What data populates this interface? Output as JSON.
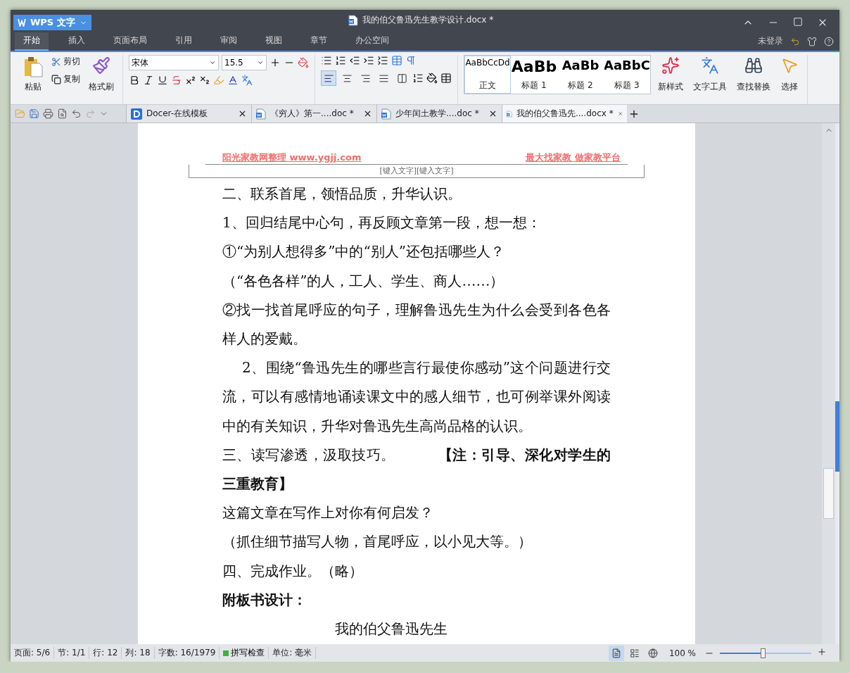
{
  "app": {
    "logo": "WPS 文字"
  },
  "window": {
    "title": "我的伯父鲁迅先生教学设计.docx *"
  },
  "menu_tabs": [
    {
      "label": "开始",
      "selected": true
    },
    {
      "label": "插入",
      "selected": false
    },
    {
      "label": "页面布局",
      "selected": false
    },
    {
      "label": "引用",
      "selected": false
    },
    {
      "label": "审阅",
      "selected": false
    },
    {
      "label": "视图",
      "selected": false
    },
    {
      "label": "章节",
      "selected": false
    },
    {
      "label": "办公空间",
      "selected": false
    }
  ],
  "account": "未登录",
  "ribbon": {
    "paste": "粘贴",
    "cut": "剪切",
    "copy": "复制",
    "format_painter": "格式刷",
    "font": {
      "name": "宋体",
      "size": "15.5"
    },
    "align_buttons": [
      {
        "selected": true
      },
      {
        "selected": false
      },
      {
        "selected": false
      },
      {
        "selected": false
      },
      {
        "selected": false
      }
    ],
    "styles": [
      {
        "preview": "AaBbCcDd",
        "label": "正文",
        "selected": true
      },
      {
        "preview": "AaBb",
        "label": "标题 1",
        "selected": false
      },
      {
        "preview": "AaBb",
        "label": "标题 2",
        "selected": false
      },
      {
        "preview": "AaBbC",
        "label": "标题 3",
        "selected": false
      }
    ],
    "tools": [
      "新样式",
      "文字工具",
      "查找替换",
      "选择"
    ]
  },
  "doc_tabs": [
    {
      "label": "Docer-在线模板",
      "kind": "docer",
      "selected": false
    },
    {
      "label": "《穷人》第一....doc *",
      "kind": "word",
      "selected": false
    },
    {
      "label": "少年闰土教学....doc *",
      "kind": "word",
      "selected": false
    },
    {
      "label": "我的伯父鲁迅先....docx *",
      "kind": "word",
      "selected": true
    }
  ],
  "header": {
    "left": "阳光家教网整理 www.ygjj.com",
    "right": "最大找家教 做家教平台",
    "placeholder": "[键入文字][键入文字]"
  },
  "paragraphs": [
    {
      "kind": "plain",
      "text": "二、联系首尾，领悟品质，升华认识。"
    },
    {
      "kind": "plain",
      "text": "1、回归结尾中心句，再反顾文章第一段，想一想："
    },
    {
      "kind": "plain",
      "text": "①“为别人想得多”中的“别人”还包括哪些人？"
    },
    {
      "kind": "plain",
      "text": "（“各色各样”的人，工人、学生、商人……）"
    },
    {
      "kind": "plain",
      "text": "②找一找首尾呼应的句子，理解鲁迅先生为什么会受到各色各样人的爱戴。"
    },
    {
      "kind": "indent",
      "text": "2、围绕“鲁迅先生的哪些言行最使你感动”这个问题进行交流，可以有感情地诵读课文中的感人细节，也可例举课外阅读中的有关知识，升华对鲁迅先生高尚品格的认识。"
    },
    {
      "kind": "plain",
      "text": "三、读写渗透，汲取技巧。　　　**【注：引导、深化对学生的三重教育】**"
    },
    {
      "kind": "plain",
      "text": "这篇文章在写作上对你有何启发？"
    },
    {
      "kind": "plain",
      "text": "（抓住细节描写人物，首尾呼应，以小见大等。）"
    },
    {
      "kind": "plain",
      "text": "四、完成作业。（略）"
    },
    {
      "kind": "bold",
      "text": "附板书设计："
    },
    {
      "kind": "center",
      "text": "我的伯父鲁迅先生"
    }
  ],
  "status_bar": {
    "items": [
      "页面: 5/6",
      "节: 1/1",
      "行: 12",
      "列: 18",
      "字数: 16/1979"
    ],
    "spell_check": "拼写检查",
    "unit": "单位: 毫米",
    "view_modes": [
      {
        "selected": true
      },
      {
        "selected": false
      },
      {
        "selected": false
      }
    ],
    "zoom": {
      "reading": "100 %",
      "level": 0.47
    }
  }
}
